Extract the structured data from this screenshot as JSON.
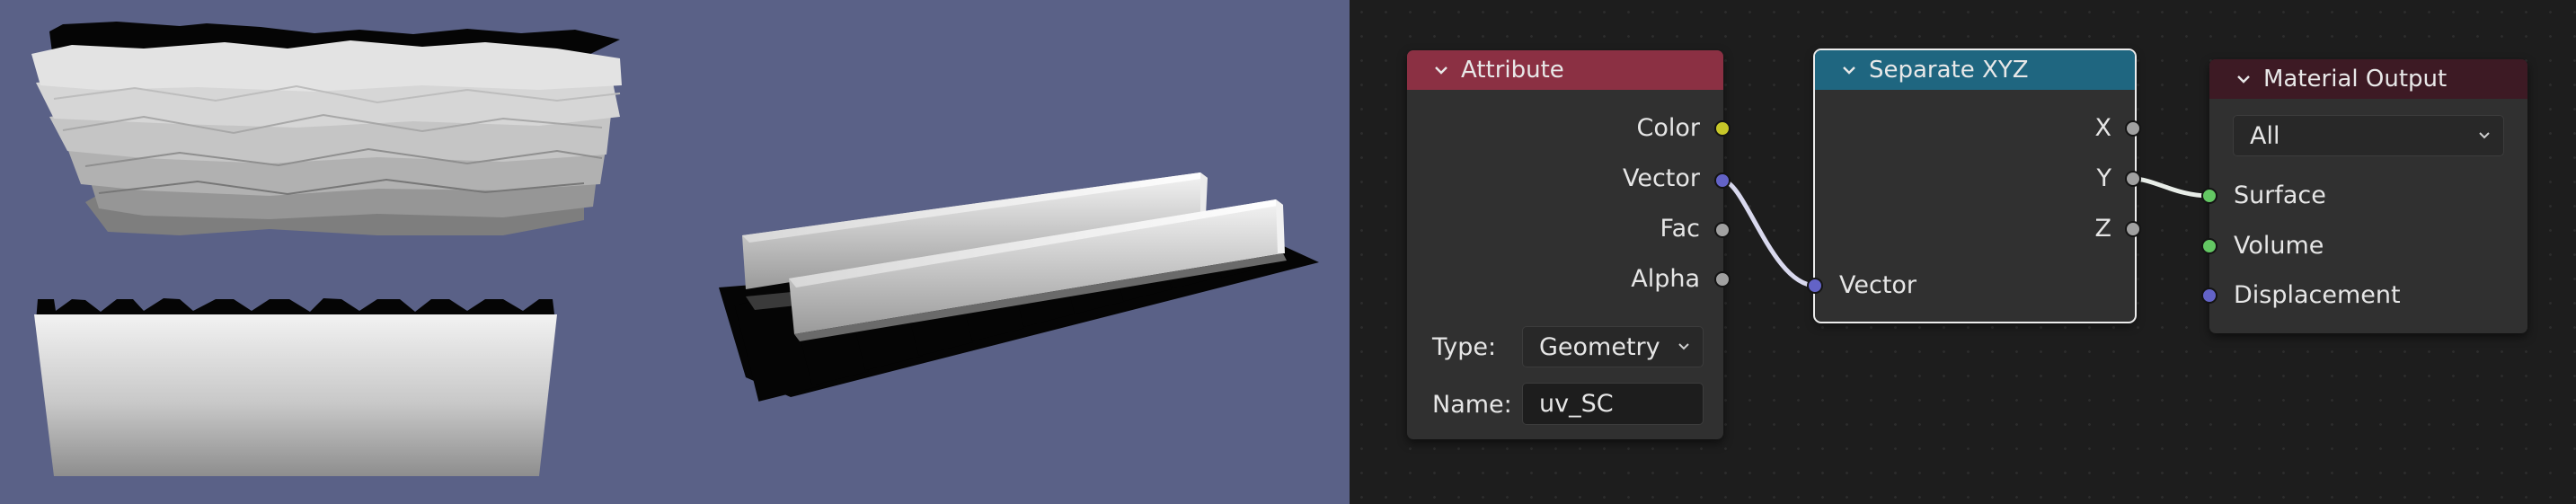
{
  "theme": {
    "viewport_bg": "#5a6187",
    "editor_bg": "#1d1d1d",
    "node_bg": "#303030",
    "attribute_header": "#8b3043",
    "separate_header": "#1f6680",
    "output_header": "#3d1a24",
    "socket_color": "#c7c729",
    "socket_vector": "#6363c7",
    "socket_float": "#a1a1a1",
    "socket_shader": "#63c763"
  },
  "viewport": {
    "objects": [
      "rock-wall-mesh",
      "wall-slab-mesh",
      "rail-track-mesh"
    ]
  },
  "nodes": {
    "attribute": {
      "title": "Attribute",
      "outputs": [
        "Color",
        "Vector",
        "Fac",
        "Alpha"
      ],
      "type_label": "Type:",
      "type_value": "Geometry",
      "name_label": "Name:",
      "name_value": "uv_SC"
    },
    "separate_xyz": {
      "title": "Separate XYZ",
      "outputs": [
        "X",
        "Y",
        "Z"
      ],
      "input": "Vector"
    },
    "material_output": {
      "title": "Material Output",
      "target": "All",
      "inputs": [
        "Surface",
        "Volume",
        "Displacement"
      ]
    }
  }
}
